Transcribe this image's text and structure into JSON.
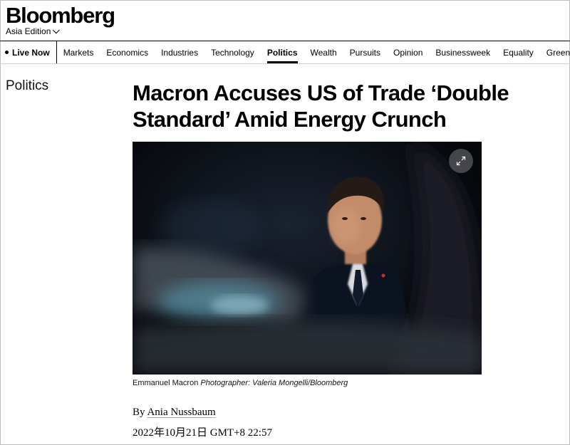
{
  "header": {
    "logo": "Bloomberg",
    "edition": "Asia Edition"
  },
  "nav": {
    "live_label": "Live Now",
    "items": [
      {
        "label": "Markets"
      },
      {
        "label": "Economics"
      },
      {
        "label": "Industries"
      },
      {
        "label": "Technology"
      },
      {
        "label": "Politics",
        "active": true
      },
      {
        "label": "Wealth"
      },
      {
        "label": "Pursuits"
      },
      {
        "label": "Opinion"
      },
      {
        "label": "Businessweek"
      },
      {
        "label": "Equality"
      },
      {
        "label": "Green"
      }
    ]
  },
  "article": {
    "section": "Politics",
    "headline": "Macron Accuses US of Trade ‘Double Standard’ Amid Energy Crunch",
    "caption_subject": "Emmanuel Macron",
    "caption_credit": "Photographer: Valeria Mongelli/Bloomberg",
    "byline_prefix": "By",
    "author": "Ania Nussbaum",
    "timestamp": "2022年10月21日 GMT+8 22:57"
  },
  "icons": {
    "expand": "expand-icon",
    "chevron": "chevron-down-icon"
  }
}
